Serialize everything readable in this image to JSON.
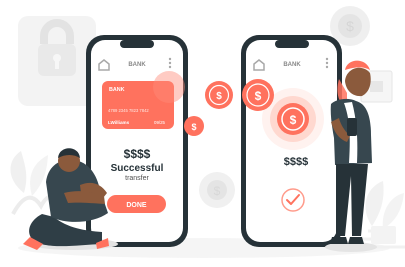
{
  "theme": {
    "accent": "#ff725e",
    "accent_light": "#ffb2a4",
    "dark": "#263238",
    "muted": "#e8e8e8",
    "skin": "#8b5a3c",
    "skin_light": "#b97b58",
    "shirt_left": "#37474f",
    "pants_left": "#2f3e46"
  },
  "left_phone": {
    "header_title": "BANK",
    "card": {
      "bank_label": "BANK",
      "number": "4789 2345 7823 7842",
      "holder": "LWilliams",
      "expiry": "09/25"
    },
    "amount": "$$$$",
    "status_line1": "Successful",
    "status_line2": "transfer",
    "done_label": "DONE",
    "icons": {
      "home": "home-icon",
      "menu": "menu-icon"
    }
  },
  "right_phone": {
    "header_title": "BANK",
    "amount": "$$$$",
    "confirm_icon": "check-icon",
    "icons": {
      "home": "home-icon",
      "menu": "menu-icon"
    }
  },
  "coins": {
    "symbol": "$"
  }
}
